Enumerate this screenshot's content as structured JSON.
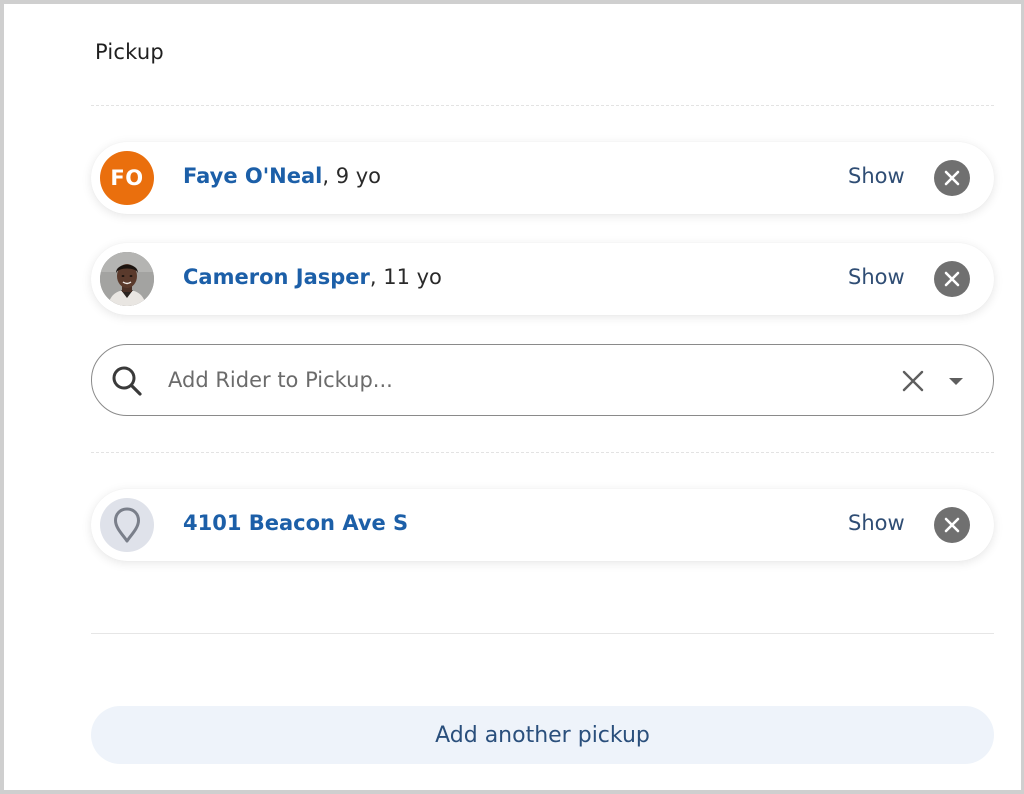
{
  "section": {
    "title": "Pickup"
  },
  "riders": [
    {
      "name": "Faye O'Neal",
      "age_suffix": ", 9 yo",
      "avatar_type": "initials",
      "initials": "FO",
      "avatar_color": "#ea6f0d",
      "show_label": "Show",
      "remove_icon": "close-circle-icon"
    },
    {
      "name": "Cameron Jasper",
      "age_suffix": ", 11 yo",
      "avatar_type": "photo",
      "show_label": "Show",
      "remove_icon": "close-circle-icon"
    }
  ],
  "search": {
    "placeholder": "Add Rider to Pickup...",
    "value": "",
    "search_icon": "search-icon",
    "clear_icon": "close-icon",
    "dropdown_icon": "caret-down-icon"
  },
  "location": {
    "address": "4101 Beacon Ave S",
    "icon": "map-pin-icon",
    "show_label": "Show",
    "remove_icon": "close-circle-icon"
  },
  "actions": {
    "add_pickup_label": "Add another pickup"
  },
  "colors": {
    "link_blue": "#1c5fa8",
    "show_text": "#2f4d74",
    "remove_bg": "#707070",
    "add_button_bg": "#eef3fa"
  }
}
